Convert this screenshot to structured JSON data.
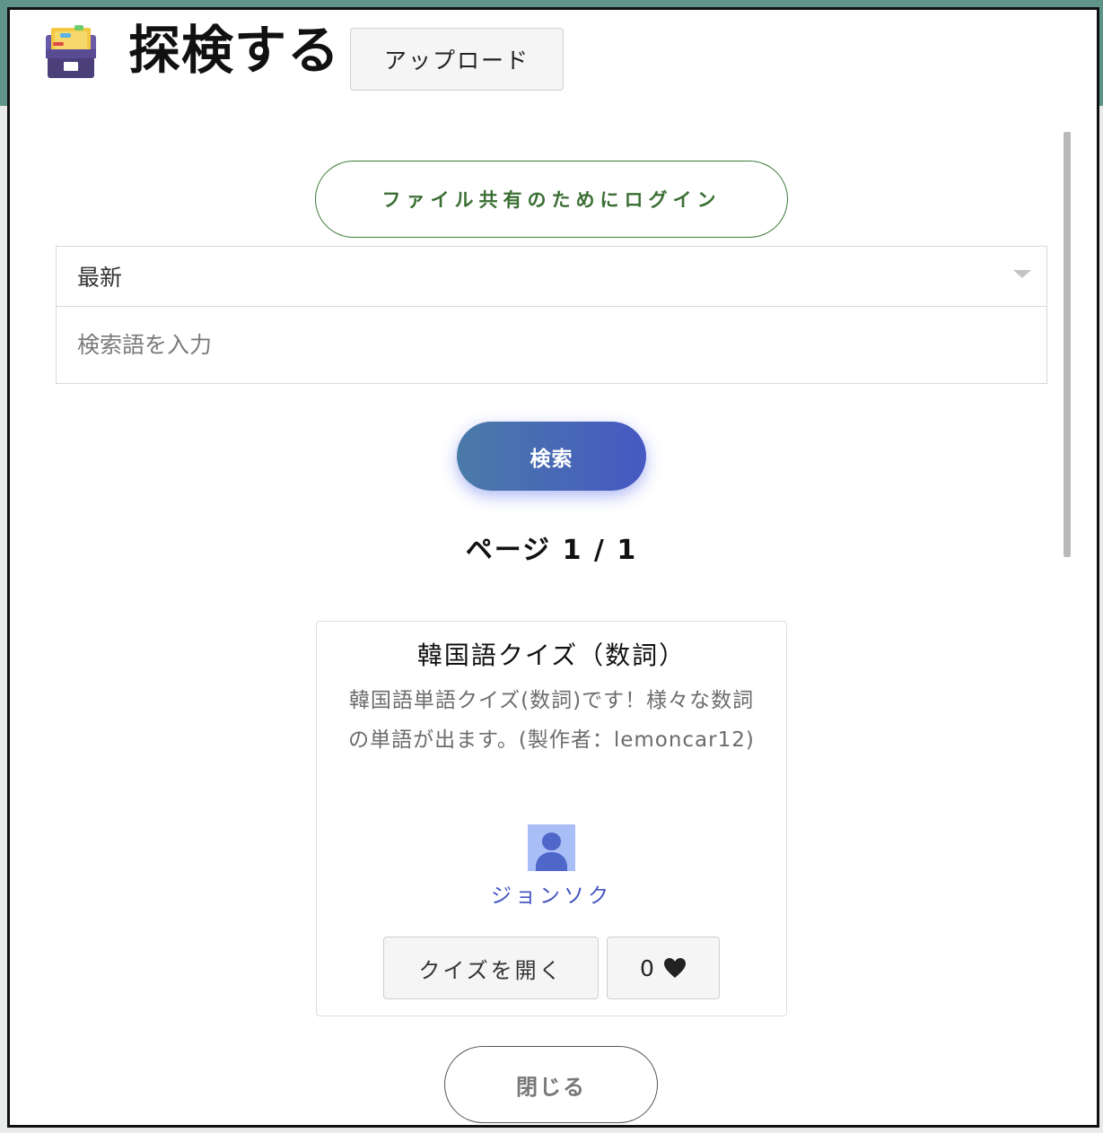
{
  "header": {
    "icon": "card-file-box-icon",
    "title": "探検する",
    "upload_label": "アップロード"
  },
  "login_label": "ファイル共有のためにログイン",
  "filters": {
    "sort_selected": "最新",
    "search_placeholder": "検索語を入力",
    "search_value": "",
    "search_label": "検索"
  },
  "pagination": {
    "text": "ページ 1 / 1"
  },
  "quizzes": [
    {
      "title": "韓国語クイズ（数詞）",
      "description": "韓国語単語クイズ(数詞)です！様々な数詞の単語が出ます。(製作者：lemoncar12)",
      "author": "ジョンソク",
      "open_label": "クイズを開く",
      "likes": "0"
    }
  ],
  "close_label": "閉じる",
  "colors": {
    "background_band": "#5f9488",
    "login_accent": "#3f7a38",
    "search_gradient_start": "#4a7aa8",
    "search_gradient_end": "#4659c2",
    "author_link": "#4455c0"
  }
}
